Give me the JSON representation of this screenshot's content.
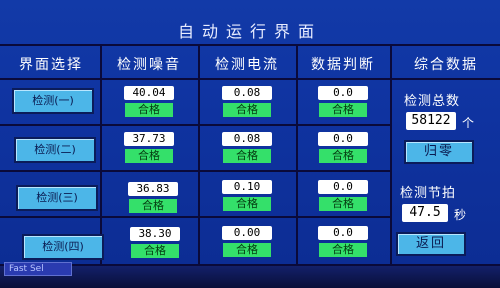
{
  "title": "自动运行界面",
  "headers": {
    "nav": "界面选择",
    "noise": "检测噪音",
    "current": "检测电流",
    "judge": "数据判断",
    "summary": "综合数据"
  },
  "rows": [
    {
      "nav": "检测(一)",
      "noise": "40.04",
      "noise_status": "合格",
      "current": "0.08",
      "current_status": "合格",
      "judge": "0.0",
      "judge_status": "合格"
    },
    {
      "nav": "检测(二)",
      "noise": "37.73",
      "noise_status": "合格",
      "current": "0.08",
      "current_status": "合格",
      "judge": "0.0",
      "judge_status": "合格"
    },
    {
      "nav": "检测(三)",
      "noise": "36.83",
      "noise_status": "合格",
      "current": "0.10",
      "current_status": "合格",
      "judge": "0.0",
      "judge_status": "合格"
    },
    {
      "nav": "检测(四)",
      "noise": "38.30",
      "noise_status": "合格",
      "current": "0.00",
      "current_status": "合格",
      "judge": "0.0",
      "judge_status": "合格"
    }
  ],
  "summary": {
    "total_label": "检测总数",
    "total_value": "58122",
    "total_unit": "个",
    "reset_button": "归零",
    "beat_label": "检测节拍",
    "beat_value": "47.5",
    "beat_unit": "秒",
    "back_button": "返回"
  },
  "footer": "Fast Sel",
  "colors": {
    "background": "#0f33a0",
    "button": "#4cb6e8",
    "ok": "#34e06a",
    "grid": "#0a0a3a"
  }
}
